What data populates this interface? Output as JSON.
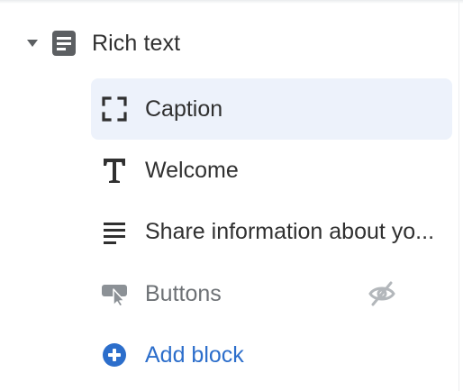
{
  "section": {
    "title": "Rich text",
    "icon": "text-section-icon"
  },
  "blocks": [
    {
      "label": "Caption",
      "icon": "caption-icon",
      "selected": true
    },
    {
      "label": "Welcome",
      "icon": "heading-icon",
      "selected": false
    },
    {
      "label": "Share information about yo...",
      "icon": "paragraph-icon",
      "selected": false
    },
    {
      "label": "Buttons",
      "icon": "buttons-icon",
      "hidden": true,
      "visibility_icon": "eye-off-icon"
    }
  ],
  "add_block": {
    "label": "Add block",
    "icon": "add-circle-icon"
  },
  "colors": {
    "selected_bg": "#edf2fb",
    "accent": "#2c6ecb",
    "text": "#303030",
    "muted": "#6d7175"
  }
}
